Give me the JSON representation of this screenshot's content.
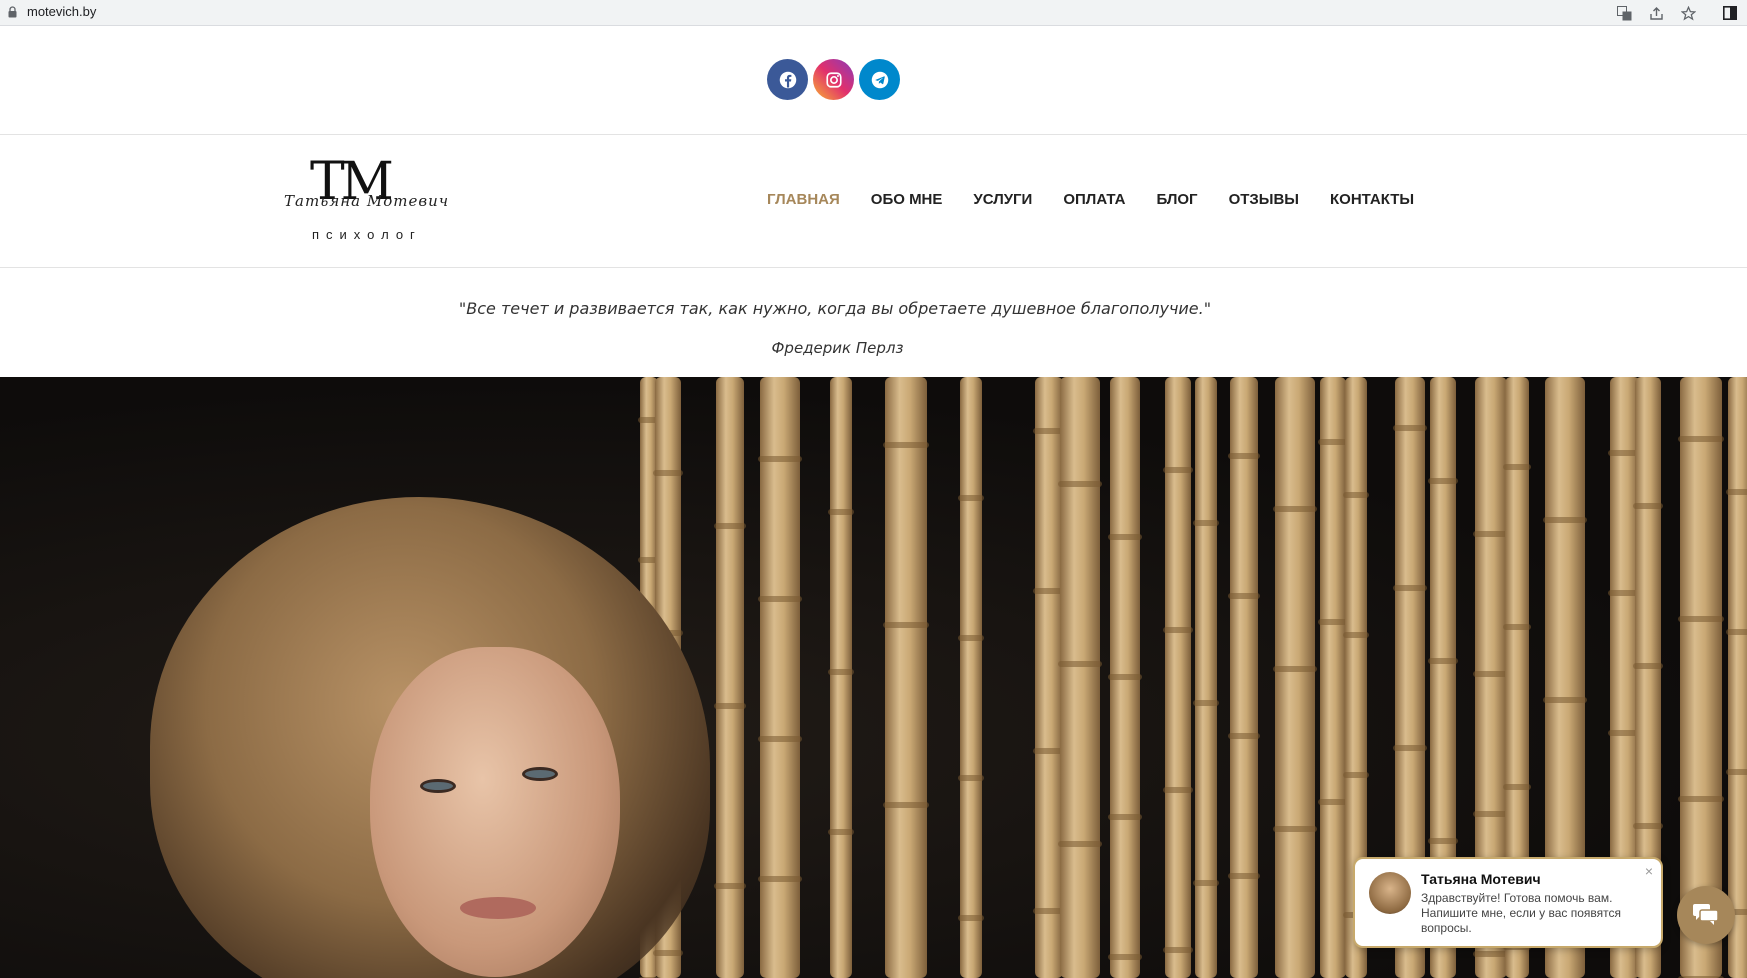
{
  "browser": {
    "url": "motevich.by",
    "icons": [
      "lock-icon",
      "translate-icon",
      "share-icon",
      "bookmark-star-icon",
      "side-panel-icon"
    ]
  },
  "social": {
    "items": [
      {
        "name": "facebook",
        "icon": "facebook-icon",
        "color": "#3b5998"
      },
      {
        "name": "instagram",
        "icon": "instagram-icon",
        "color": "#e1306c"
      },
      {
        "name": "telegram",
        "icon": "telegram-icon",
        "color": "#0088cc"
      }
    ]
  },
  "logo": {
    "monogram": "TM",
    "script": "Татьяна Мотевич",
    "subtitle": "психолог"
  },
  "nav": {
    "items": [
      {
        "label": "ГЛАВНАЯ",
        "active": true
      },
      {
        "label": "ОБО МНЕ",
        "active": false
      },
      {
        "label": "УСЛУГИ",
        "active": false
      },
      {
        "label": "ОПЛАТА",
        "active": false
      },
      {
        "label": "БЛОГ",
        "active": false
      },
      {
        "label": "ОТЗЫВЫ",
        "active": false
      },
      {
        "label": "КОНТАКТЫ",
        "active": false
      }
    ],
    "active_color": "#a6875a"
  },
  "quote": {
    "text": "\"Все течет и развивается так, как нужно, когда вы обретаете душевное благополучие.\"",
    "author": "Фредерик Перлз"
  },
  "chat": {
    "name": "Татьяна Мотевич",
    "message": "Здравствуйте! Готова помочь вам. Напишите мне, если у вас появятся вопросы.",
    "close": "×",
    "accent": "#c7a96b",
    "button_icon": "chat-icon"
  }
}
